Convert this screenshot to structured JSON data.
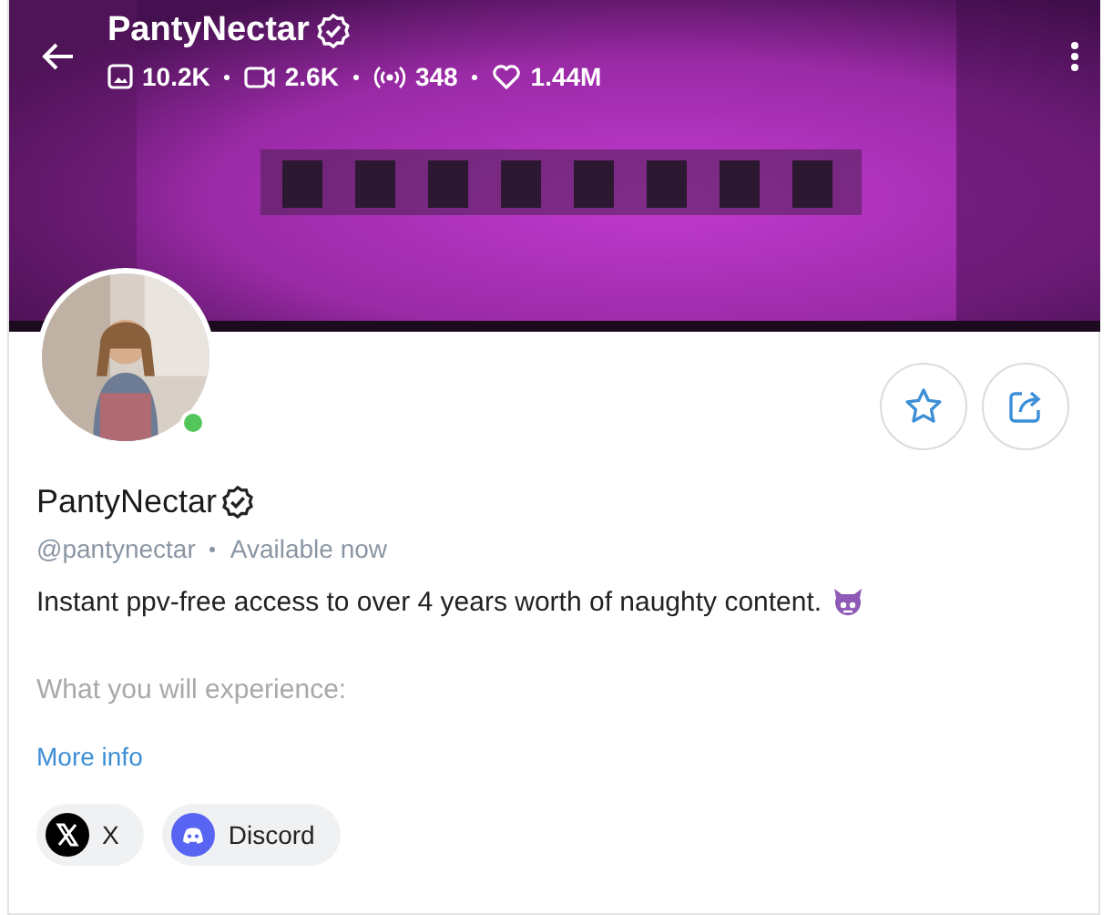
{
  "header": {
    "title": "PantyNectar",
    "verified": true,
    "stats": [
      {
        "kind": "photos",
        "value": "10.2K"
      },
      {
        "kind": "videos",
        "value": "2.6K"
      },
      {
        "kind": "streams",
        "value": "348"
      },
      {
        "kind": "likes",
        "value": "1.44M"
      }
    ]
  },
  "profile": {
    "name": "PantyNectar",
    "verified": true,
    "online": true,
    "handle": "@pantynectar",
    "availability": "Available now",
    "bio": "Instant ppv-free access to over 4 years worth of naughty content.",
    "bio_more": "What you will experience:",
    "more_info": "More info"
  },
  "social_links": [
    {
      "kind": "x",
      "label": "X"
    },
    {
      "kind": "discord",
      "label": "Discord"
    }
  ]
}
